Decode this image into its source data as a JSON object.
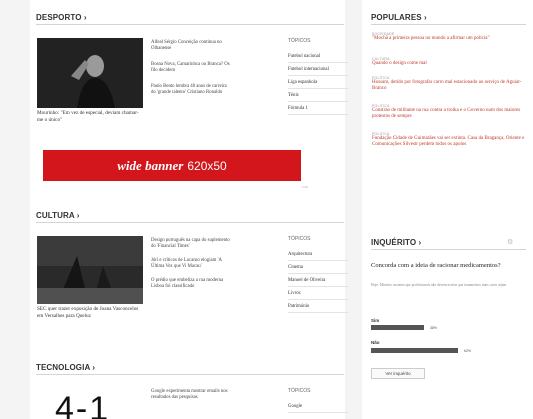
{
  "sections": {
    "desporto": {
      "title": "DESPORTO ›"
    },
    "cultura": {
      "title": "CULTURA ›"
    },
    "tecnologia": {
      "title": "TECNOLOGIA ›"
    }
  },
  "desporto": {
    "caption": "Mourinho: \"Em vez de especial, deviam chamar-me o único\"",
    "stories": [
      "Alfeal Sérgio Conceição continua no Olhanense",
      "Bosna Nova, Camarinhca ou Branca? Os filo decidem",
      "Paulo Bento lembra 40 anos de carreira do 'grande talento' Cristiano Ronaldo"
    ],
    "topics_heading": "TÓPICOS",
    "topics": [
      "Futebol nacional",
      "Futebol internacional",
      "Liga espanhola",
      "Ténis",
      "Fórmula 1"
    ]
  },
  "banner": {
    "label_italic": "wide banner",
    "label_size": "620x50",
    "ad_tag": "PUB"
  },
  "cultura": {
    "caption": "SEC quer trazer exposição de Joana Vasconcelos em Versalhes para Queluz",
    "stories": [
      "Design português na capa do suplemento do 'Financial Times'",
      "Júri e críticos de Locarno elogiam 'A Última Vez que Vi Macau'",
      "O prédio que embeliza a rua moderna Lisboa foi classificado"
    ],
    "topics_heading": "TÓPICOS",
    "topics": [
      "Arquitectura",
      "Cinema",
      "Manoel de Oliveira",
      "Livros",
      "Património"
    ]
  },
  "tecnologia": {
    "stories": [
      "Google experimenta mostrar emails nos resultados das pesquisas"
    ],
    "topics_heading": "TÓPICOS",
    "topics": [
      "Google"
    ],
    "image_text": "4-1"
  },
  "populares": {
    "title": "POPULARES ›",
    "items": [
      {
        "cat": "SOCIEDADE",
        "text": "\"Mochã a primeira pessoa no mundo a afirmar um polícia\""
      },
      {
        "cat": "CULTURA",
        "text": "Quando o design come mal"
      },
      {
        "cat": "POLÍTICA",
        "text": "Hossam, detido por fotografar carro mal estacionado ao serviço de Aguiar-Branco"
      },
      {
        "cat": "POLÍTICA",
        "text": "Constrao de militante na rua contra a troika e o Governo num dos maiores protestos de sempre"
      },
      {
        "cat": "POLÍTICA",
        "text": "Fundação Cidade de Guimarães vai ser extinta. Casa da Bragança, Oriente e Comunicações Silvestr perdem todos os apoios"
      }
    ]
  },
  "inquerito": {
    "title": "INQUÉRITO ›",
    "question": "Concorda com a ideia de racionar medicamentos?",
    "note": "Hoje: Ministro sustenta que profissionais não devem aceitar que tratamentos mais caros sejam",
    "options": [
      {
        "label": "Sim",
        "percent": 38,
        "pct_label": "38%"
      },
      {
        "label": "Não",
        "percent": 62,
        "pct_label": "62%"
      }
    ],
    "vote_label": "Ver inquérito"
  }
}
